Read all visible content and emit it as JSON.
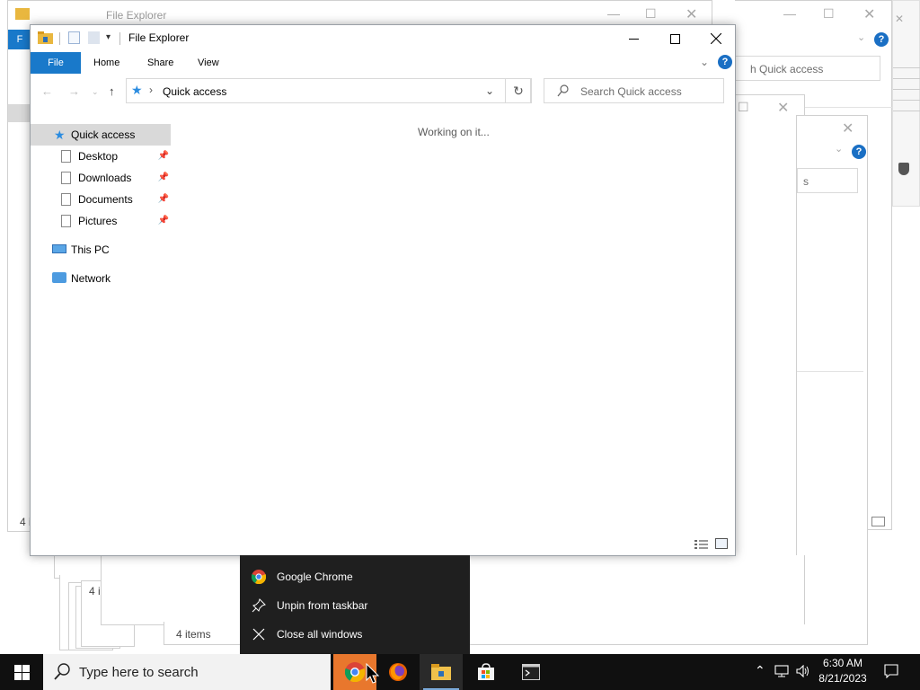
{
  "window": {
    "title": "File Explorer",
    "tabs": {
      "file": "File",
      "home": "Home",
      "share": "Share",
      "view": "View"
    },
    "help": "?",
    "address": "Quick access",
    "search_placeholder": "Search Quick access",
    "status_message": "Working on it..."
  },
  "nav_pane": {
    "quick_access": "Quick access",
    "pinned": [
      "Desktop",
      "Downloads",
      "Documents",
      "Pictures"
    ],
    "this_pc": "This PC",
    "network": "Network"
  },
  "background_windows": {
    "title": "File Explorer",
    "search_placeholder_partial": "h Quick access",
    "status_items": "4 items",
    "status_partial_a": "4 i",
    "status_partial_b": "4 i",
    "file_tab_partial": "F",
    "search_partial_2": "s",
    "help": "?"
  },
  "jump_list": {
    "items": [
      {
        "label": "Google Chrome",
        "icon": "chrome-icon"
      },
      {
        "label": "Unpin from taskbar",
        "icon": "unpin-icon"
      },
      {
        "label": "Close all windows",
        "icon": "close-icon"
      }
    ]
  },
  "taskbar": {
    "search_placeholder": "Type here to search",
    "time": "6:30 AM",
    "date": "8/21/2023",
    "apps": [
      "chrome-icon",
      "firefox-icon",
      "file-explorer-icon",
      "store-icon",
      "terminal-icon"
    ]
  },
  "colors": {
    "file_tab": "#1979ca",
    "taskbar": "#101010",
    "active_app": "#e8772d",
    "jump_list": "#1f1f1f"
  }
}
